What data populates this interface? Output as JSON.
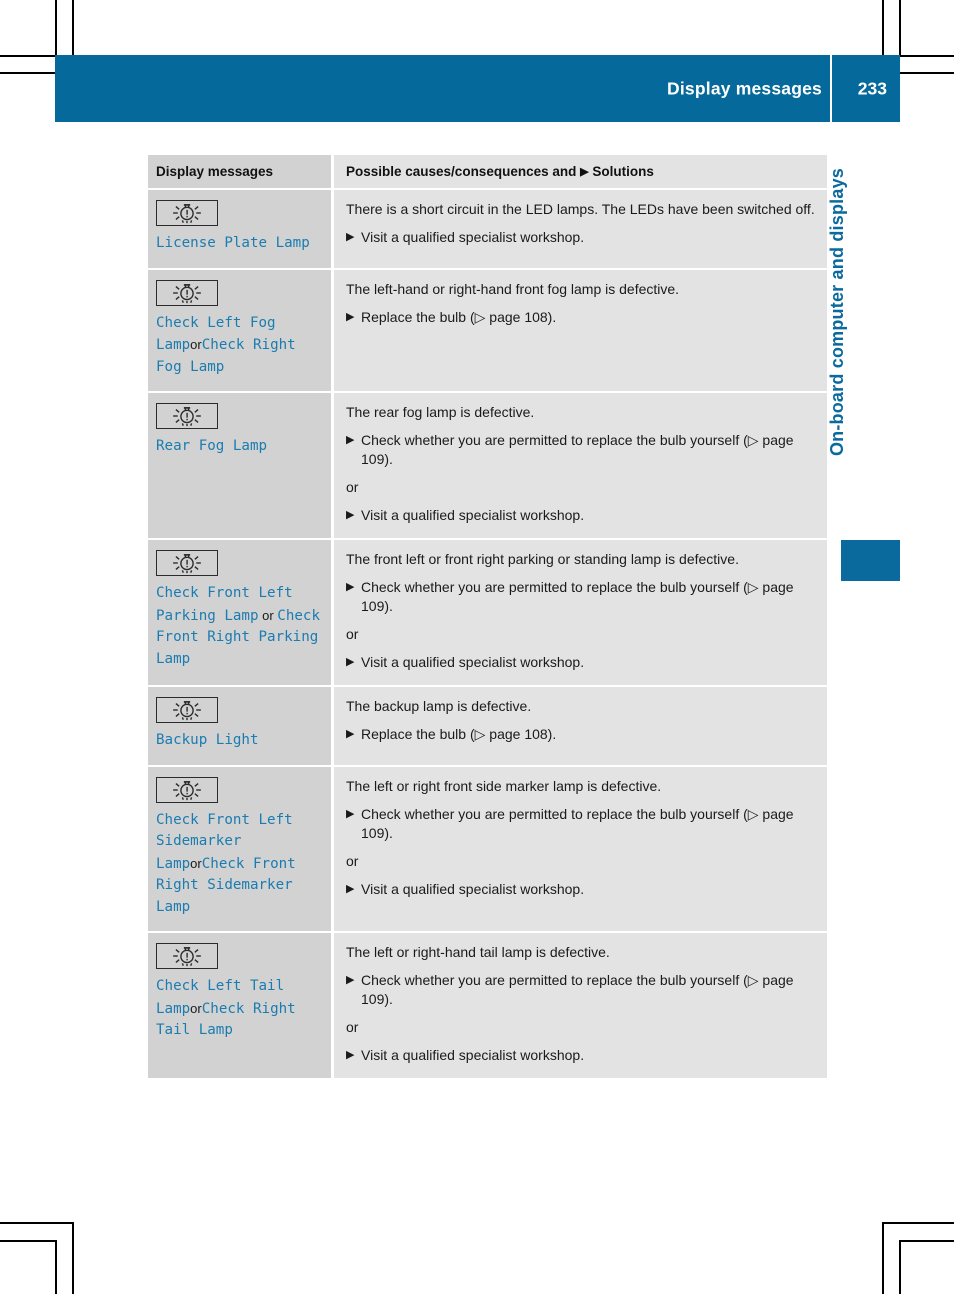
{
  "header": {
    "title": "Display messages",
    "page_number": "233"
  },
  "side_tab": {
    "label": "On-board computer and displays"
  },
  "table": {
    "columns": {
      "left": "Display messages",
      "right_prefix": "Possible causes/consequences and",
      "right_triangle": "▶",
      "right_suffix": "Solutions"
    },
    "rows": [
      {
        "icon": "lamp-warning-icon",
        "message_parts": [
          {
            "text": "License Plate Lamp",
            "style": "message"
          }
        ],
        "cause": "There is a short circuit in the LED lamps. The LEDs have been switched off.",
        "blocks": [
          {
            "type": "solution",
            "text": "Visit a qualified specialist workshop."
          }
        ]
      },
      {
        "icon": "lamp-warning-icon",
        "message_parts": [
          {
            "text": "Check Left Fog Lamp",
            "style": "message"
          },
          {
            "text": "or",
            "style": "or-inline"
          },
          {
            "text": "Check Right Fog Lamp",
            "style": "message"
          }
        ],
        "cause": "The left-hand or right-hand front fog lamp is defective.",
        "blocks": [
          {
            "type": "solution",
            "text": "Replace the bulb (▷ page 108)."
          }
        ]
      },
      {
        "icon": "lamp-warning-icon",
        "message_parts": [
          {
            "text": "Rear Fog Lamp",
            "style": "message"
          }
        ],
        "cause": "The rear fog lamp is defective.",
        "blocks": [
          {
            "type": "solution",
            "text": "Check whether you are permitted to replace the bulb yourself (▷ page 109)."
          },
          {
            "type": "or",
            "text": "or"
          },
          {
            "type": "solution",
            "text": "Visit a qualified specialist workshop."
          }
        ]
      },
      {
        "icon": "lamp-warning-icon",
        "message_parts": [
          {
            "text": "Check Front Left Parking Lamp",
            "style": "message"
          },
          {
            "text": " or ",
            "style": "or-inline"
          },
          {
            "text": "Check Front Right Parking Lamp",
            "style": "message"
          }
        ],
        "cause": "The front left or front right parking or standing lamp is defective.",
        "blocks": [
          {
            "type": "solution",
            "text": "Check whether you are permitted to replace the bulb yourself (▷ page 109)."
          },
          {
            "type": "or",
            "text": "or"
          },
          {
            "type": "solution",
            "text": "Visit a qualified specialist workshop."
          }
        ]
      },
      {
        "icon": "lamp-warning-icon",
        "message_parts": [
          {
            "text": "Backup Light",
            "style": "message"
          }
        ],
        "cause": "The backup lamp is defective.",
        "blocks": [
          {
            "type": "solution",
            "text": "Replace the bulb (▷ page 108)."
          }
        ]
      },
      {
        "icon": "lamp-warning-icon",
        "message_parts": [
          {
            "text": "Check Front Left Sidemarker Lamp",
            "style": "message"
          },
          {
            "text": "or",
            "style": "or-inline"
          },
          {
            "text": "Check Front Right Sidemarker Lamp",
            "style": "message"
          }
        ],
        "cause": "The left or right front side marker lamp is defective.",
        "blocks": [
          {
            "type": "solution",
            "text": "Check whether you are permitted to replace the bulb yourself (▷ page 109)."
          },
          {
            "type": "or",
            "text": "or"
          },
          {
            "type": "solution",
            "text": "Visit a qualified specialist workshop."
          }
        ]
      },
      {
        "icon": "lamp-warning-icon",
        "message_parts": [
          {
            "text": "Check Left Tail Lamp",
            "style": "message"
          },
          {
            "text": "or",
            "style": "or-inline"
          },
          {
            "text": "Check Right Tail Lamp",
            "style": "message"
          }
        ],
        "cause": "The left or right-hand tail lamp is defective.",
        "blocks": [
          {
            "type": "solution",
            "text": "Check whether you are permitted to replace the bulb yourself (▷ page 109)."
          },
          {
            "type": "or",
            "text": "or"
          },
          {
            "type": "solution",
            "text": "Visit a qualified specialist workshop."
          }
        ]
      }
    ]
  },
  "colors": {
    "brand_blue": "#056a9b",
    "message_blue": "#1a7cb0",
    "col_left_bg": "#d2d2d2",
    "col_right_bg": "#e3e3e3"
  }
}
